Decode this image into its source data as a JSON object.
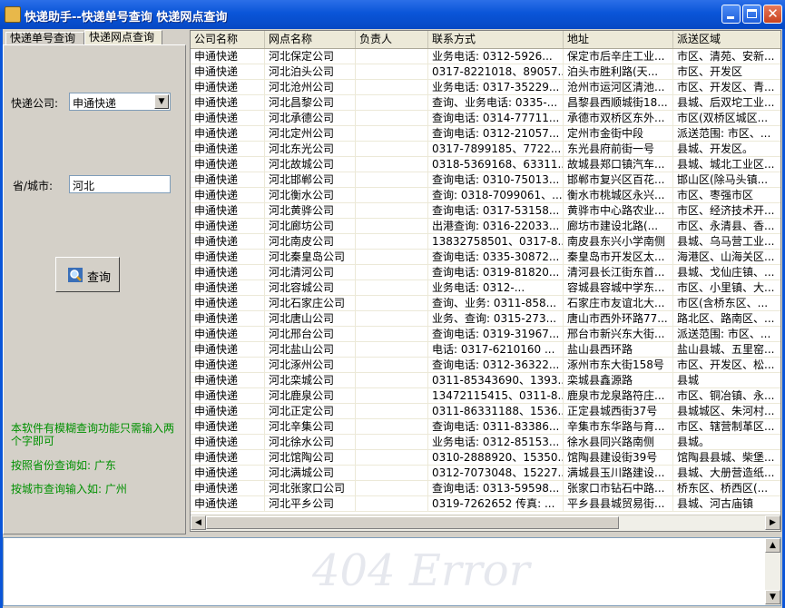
{
  "window": {
    "title": "快递助手--快递单号查询 快递网点查询"
  },
  "tabs": [
    {
      "label": "快递单号查询"
    },
    {
      "label": "快递网点查询"
    }
  ],
  "form": {
    "company_label": "快递公司:",
    "company_value": "申通快递",
    "city_label": "省/城市:",
    "city_value": "河北",
    "query_button": "查询"
  },
  "hints": {
    "fuzzy": "本软件有模糊查询功能只需输入两个字即可",
    "province": "按照省份查询如: 广东",
    "city": "按城市查询输入如: 广州"
  },
  "table": {
    "columns": [
      "公司名称",
      "网点名称",
      "负责人",
      "联系方式",
      "地址",
      "派送区域"
    ],
    "rows": [
      [
        "申通快递",
        "河北保定公司",
        "",
        "业务电话: 0312-5926...",
        "保定市后辛庄工业...",
        "市区、清苑、安新..."
      ],
      [
        "申通快递",
        "河北泊头公司",
        "",
        "0317-8221018、89057...",
        "泊头市胜利路(天...",
        "市区、开发区"
      ],
      [
        "申通快递",
        "河北沧州公司",
        "",
        "业务电话: 0317-35229...",
        "沧州市运河区清池...",
        "市区、开发区、青..."
      ],
      [
        "申通快递",
        "河北昌黎公司",
        "",
        "查询、业务电话: 0335-...",
        "昌黎县西顺城街18...",
        "县城、后双坨工业..."
      ],
      [
        "申通快递",
        "河北承德公司",
        "",
        "查询电话: 0314-77711...",
        "承德市双桥区东外...",
        "市区(双桥区城区..."
      ],
      [
        "申通快递",
        "河北定州公司",
        "",
        "查询电话: 0312-21057...",
        "定州市金街中段",
        "派送范围: 市区、..."
      ],
      [
        "申通快递",
        "河北东光公司",
        "",
        "0317-7899185、7722...",
        "东光县府前街一号",
        "县城、开发区。"
      ],
      [
        "申通快递",
        "河北故城公司",
        "",
        "0318-5369168、63311...",
        "故城县郑口镇汽车...",
        "县城、城北工业区..."
      ],
      [
        "申通快递",
        "河北邯郸公司",
        "",
        "查询电话: 0310-75013...",
        "邯郸市复兴区百花...",
        "邯山区(除马头镇..."
      ],
      [
        "申通快递",
        "河北衡水公司",
        "",
        "查询: 0318-7099061、...",
        "衡水市桃城区永兴...",
        "市区、枣强市区"
      ],
      [
        "申通快递",
        "河北黄骅公司",
        "",
        "查询电话: 0317-53158...",
        "黄骅市中心路农业...",
        "市区、经济技术开..."
      ],
      [
        "申通快递",
        "河北廊坊公司",
        "",
        "出港查询: 0316-22033...",
        "廊坊市建设北路(...",
        "市区、永清县、香..."
      ],
      [
        "申通快递",
        "河北南皮公司",
        "",
        "13832758501、0317-8...",
        "南皮县东兴小学南侧",
        "县城、乌马营工业..."
      ],
      [
        "申通快递",
        "河北秦皇岛公司",
        "",
        "查询电话: 0335-30872...",
        "秦皇岛市开发区太...",
        "海港区、山海关区..."
      ],
      [
        "申通快递",
        "河北清河公司",
        "",
        "查询电话: 0319-81820...",
        "清河县长江街东首...",
        "县城、戈仙庄镇、..."
      ],
      [
        "申通快递",
        "河北容城公司",
        "",
        "业务电话: 0312-...",
        "容城县容城中学东...",
        "市区、小里镇、大..."
      ],
      [
        "申通快递",
        "河北石家庄公司",
        "",
        "查询、业务: 0311-858...",
        "石家庄市友谊北大...",
        "市区(含桥东区、..."
      ],
      [
        "申通快递",
        "河北唐山公司",
        "",
        "业务、查询: 0315-273...",
        "唐山市西外环路77...",
        "路北区、路南区、..."
      ],
      [
        "申通快递",
        "河北邢台公司",
        "",
        "查询电话: 0319-31967...",
        "邢台市新兴东大街...",
        "派送范围: 市区、..."
      ],
      [
        "申通快递",
        "河北盐山公司",
        "",
        "电话: 0317-6210160 ...",
        "盐山县西环路",
        "盐山县城、五里窑..."
      ],
      [
        "申通快递",
        "河北涿州公司",
        "",
        "查询电话: 0312-36322...",
        "涿州市东大街158号",
        "市区、开发区、松..."
      ],
      [
        "申通快递",
        "河北栾城公司",
        "",
        "0311-85343690、1393...",
        "栾城县鑫源路",
        "县城"
      ],
      [
        "申通快递",
        "河北鹿泉公司",
        "",
        "13472115415、0311-8...",
        "鹿泉市龙泉路符庄...",
        "市区、铜冶镇、永..."
      ],
      [
        "申通快递",
        "河北正定公司",
        "",
        "0311-86331188、1536...",
        "正定县城西街37号",
        "县城城区、朱河村..."
      ],
      [
        "申通快递",
        "河北辛集公司",
        "",
        "查询电话: 0311-83386...",
        "辛集市东华路与育...",
        "市区、辖营制革区..."
      ],
      [
        "申通快递",
        "河北徐水公司",
        "",
        "业务电话: 0312-85153...",
        "徐水县同兴路南侧",
        "县城。"
      ],
      [
        "申通快递",
        "河北馆陶公司",
        "",
        "0310-2888920、15350...",
        "馆陶县建设街39号",
        "馆陶县县城、柴堡..."
      ],
      [
        "申通快递",
        "河北满城公司",
        "",
        "0312-7073048、15227...",
        "满城县玉川路建设...",
        "县城、大册营造纸..."
      ],
      [
        "申通快递",
        "河北张家口公司",
        "",
        "查询电话: 0313-59598...",
        "张家口市钻石中路...",
        "桥东区、桥西区(..."
      ],
      [
        "申通快递",
        "河北平乡公司",
        "",
        "0319-7262652 传真: ...",
        "平乡县县城贸易街...",
        "县城、河古庙镇"
      ]
    ]
  },
  "watermark": "404 Error"
}
